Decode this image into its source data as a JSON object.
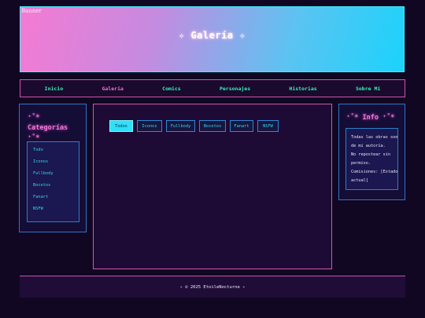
{
  "banner": {
    "alt_text": "Banner",
    "title": "✧ Galería ✧"
  },
  "nav": {
    "items": [
      "Inicio",
      "Galería",
      "Comics",
      "Personajes",
      "Historias",
      "Sobre Mí"
    ],
    "active": "Galería"
  },
  "categories": {
    "title": "⁺˚*  Categorías ⁺˚*",
    "items": [
      "Todo",
      "Iconos",
      "Fullbody",
      "Bocetos",
      "Fanart",
      "NSFW"
    ]
  },
  "filters": {
    "items": [
      "Todos",
      "Iconos",
      "Fullbody",
      "Bocetos",
      "Fanart",
      "NSFW"
    ],
    "active": "Todos"
  },
  "info": {
    "title": "⁺˚*  Info ⁺˚*",
    "lines": [
      "Todas las obras son",
      "de mi autoría.",
      "No repostear sin",
      "permiso.",
      "Comisiones: [Estado",
      "actual]"
    ]
  },
  "footer": {
    "text": "✧ © 2025 EtoileNocturne ✧"
  },
  "colors": {
    "accent_cyan": "#2ee0f8",
    "accent_pink": "#f374d9",
    "nav_green": "#3cf0b5",
    "background": "#110722"
  }
}
